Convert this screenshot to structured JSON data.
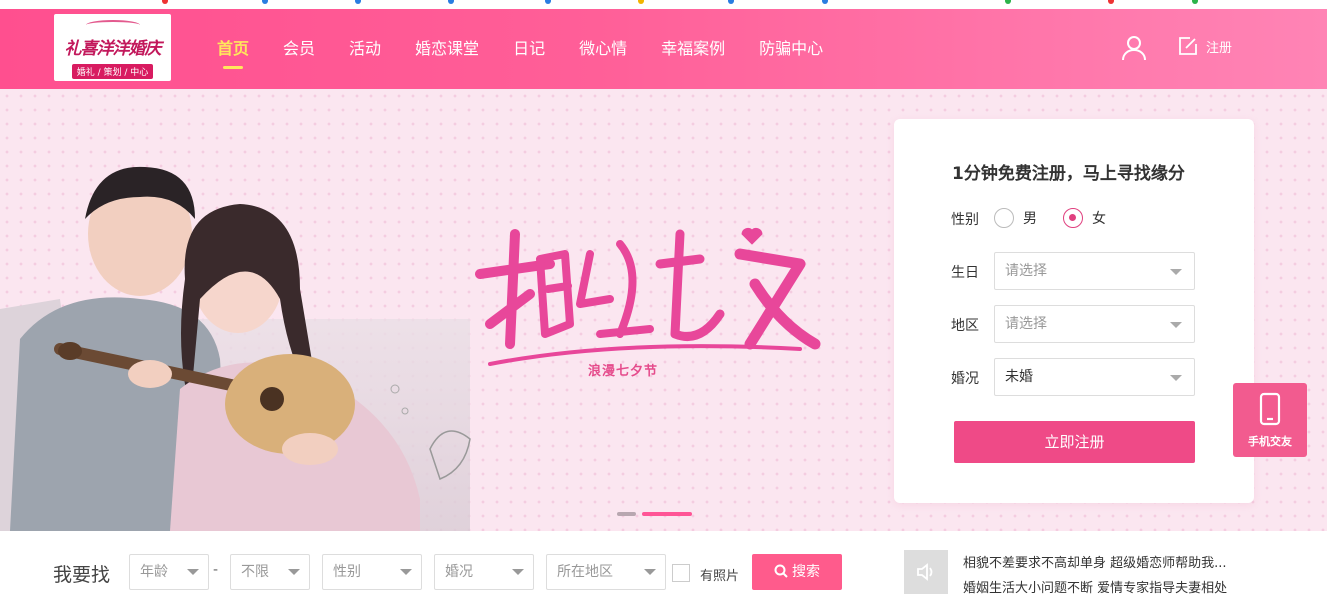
{
  "header": {
    "logo": {
      "main": "礼喜洋洋婚庆",
      "sub": "婚礼 / 策划 / 中心"
    },
    "nav": [
      "首页",
      "会员",
      "活动",
      "婚恋课堂",
      "日记",
      "微心情",
      "幸福案例",
      "防骗中心"
    ],
    "active_nav_index": 0,
    "register_label": "注册",
    "icons": {
      "user": "user-icon",
      "register": "edit-icon"
    }
  },
  "banner": {
    "title": "相约七夕",
    "subtitle": "浪漫七夕节"
  },
  "register_form": {
    "title": "1分钟免费注册，马上寻找缘分",
    "gender_label": "性别",
    "gender_options": [
      "男",
      "女"
    ],
    "gender_selected": "女",
    "birthday_label": "生日",
    "birthday_placeholder": "请选择",
    "region_label": "地区",
    "region_placeholder": "请选择",
    "marital_label": "婚况",
    "marital_value": "未婚",
    "submit_label": "立即注册"
  },
  "mobile_widget": {
    "label": "手机交友",
    "icon": "phone-icon"
  },
  "search": {
    "title": "我要找",
    "age_from": "年龄",
    "age_to": "不限",
    "gender": "性别",
    "marital": "婚况",
    "region": "所在地区",
    "photo_label": "有照片",
    "button_label": "搜索",
    "icon": "search-icon"
  },
  "news": {
    "icon": "speaker-icon",
    "items": [
      "相貌不差要求不高却单身 超级婚恋师帮助我...",
      "婚姻生活大小问题不断 爱情专家指导夫妻相处"
    ]
  },
  "colors": {
    "primary": "#ff5a94",
    "accent": "#ffe75c",
    "button": "#ef4a87"
  }
}
